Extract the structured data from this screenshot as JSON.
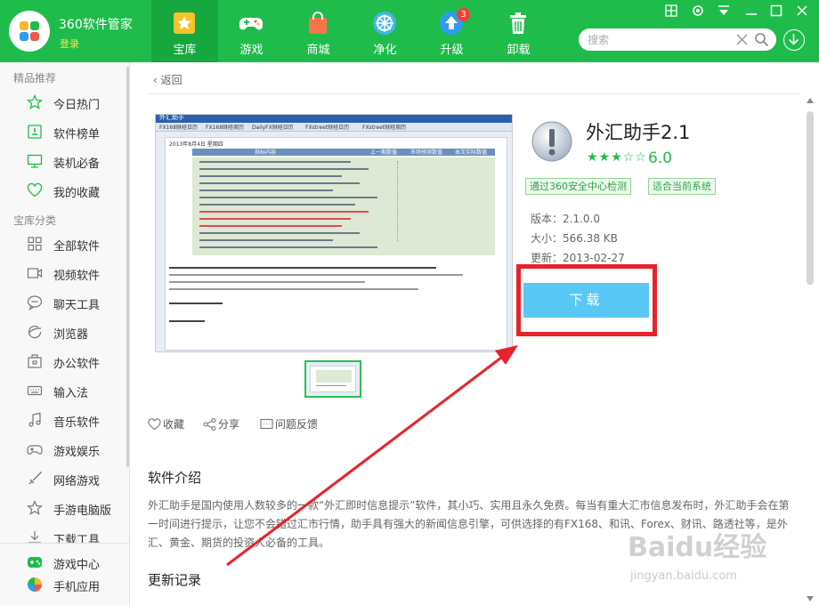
{
  "brand": {
    "name": "360软件管家",
    "login": "登录"
  },
  "nav": {
    "tabs": [
      {
        "label": "宝库",
        "icon": "star-icon"
      },
      {
        "label": "游戏",
        "icon": "gamepad-icon"
      },
      {
        "label": "商城",
        "icon": "shopping-bag-icon"
      },
      {
        "label": "净化",
        "icon": "clean-icon"
      },
      {
        "label": "升级",
        "icon": "upgrade-icon",
        "badge": "3"
      },
      {
        "label": "卸载",
        "icon": "trash-icon"
      }
    ],
    "active": "宝库"
  },
  "search": {
    "placeholder": "搜索"
  },
  "sidebar": {
    "featured_title": "精品推荐",
    "featured": [
      {
        "label": "今日热门",
        "icon": "star-outline-icon"
      },
      {
        "label": "软件榜单",
        "icon": "rank-icon"
      },
      {
        "label": "装机必备",
        "icon": "monitor-icon"
      },
      {
        "label": "我的收藏",
        "icon": "heart-icon"
      }
    ],
    "categories_title": "宝库分类",
    "categories": [
      {
        "label": "全部软件",
        "icon": "grid-icon"
      },
      {
        "label": "视频软件",
        "icon": "video-icon"
      },
      {
        "label": "聊天工具",
        "icon": "chat-icon"
      },
      {
        "label": "浏览器",
        "icon": "browser-icon"
      },
      {
        "label": "办公软件",
        "icon": "office-icon"
      },
      {
        "label": "输入法",
        "icon": "keyboard-icon"
      },
      {
        "label": "音乐软件",
        "icon": "music-icon"
      },
      {
        "label": "游戏娱乐",
        "icon": "gamepad-outline-icon"
      },
      {
        "label": "网络游戏",
        "icon": "sword-icon"
      },
      {
        "label": "手游电脑版",
        "icon": "star-outline-icon"
      },
      {
        "label": "下载工具",
        "icon": "download-icon"
      }
    ],
    "bottom": [
      {
        "label": "游戏中心",
        "icon": "game-center-icon"
      },
      {
        "label": "手机应用",
        "icon": "mobile-apps-icon"
      }
    ]
  },
  "detail": {
    "back": "返回",
    "title": "外汇助手2.1",
    "stars": "★★★☆☆",
    "rating": "6.0",
    "tags": [
      "通过360安全中心检测",
      "适合当前系统"
    ],
    "version": "版本：2.1.0.0",
    "size": "大小：566.38 KB",
    "updated": "更新：2013-02-27",
    "download": "下载",
    "actions": {
      "favorite": "收藏",
      "share": "分享",
      "feedback": "问题反馈"
    },
    "intro_title": "软件介绍",
    "intro": "外汇助手是国内使用人数较多的一款“外汇即时信息提示”软件，其小巧、实用且永久免费。每当有重大汇市信息发布时，外汇助手会在第一时间进行提示，让您不会错过汇市行情，助手具有强大的新闻信息引擎，可供选择的有FX168、和讯、Forex、财讯、路透社等，是外汇、黄金、期货的投资人必备的工具。",
    "changelog_title": "更新记录"
  },
  "screenshot": {
    "title_bar": "外汇助手",
    "tabs": [
      "FX168财经日历",
      "FX168财经周历",
      "DailyFX财经日历",
      "FXstreet财经日历",
      "FXstreet财经周历"
    ],
    "date": "2013年8月4日  星期四",
    "col_headers": [
      "指标内容",
      "上一期数值",
      "市场预测数值",
      "本次实际数值"
    ]
  },
  "watermark": {
    "text": "Baidu经验",
    "sub": "jingyan.baidu.com"
  }
}
